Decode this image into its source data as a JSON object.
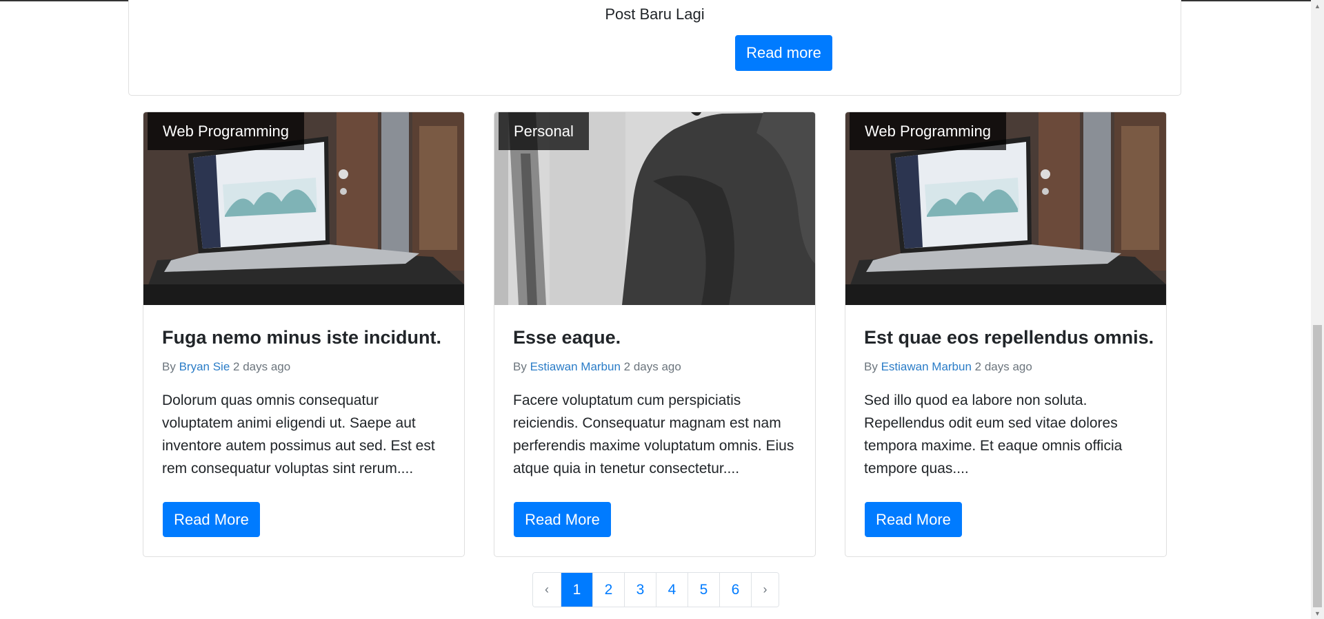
{
  "hero": {
    "title": "Post Baru Lagi",
    "button_label": "Read more"
  },
  "cards": [
    {
      "category": "Web Programming",
      "image": "laptop-dashboard",
      "title": "Fuga nemo minus iste incidunt.",
      "by": "By",
      "author": "Bryan Sie",
      "time": "2 days ago",
      "excerpt": "Dolorum quas omnis consequatur voluptatem animi eligendi ut. Saepe aut inventore autem possimus aut sed. Est est rem consequatur voluptas sint rerum....",
      "button_label": "Read More"
    },
    {
      "category": "Personal",
      "image": "person-grayscale",
      "title": "Esse eaque.",
      "by": "By",
      "author": "Estiawan Marbun",
      "time": "2 days ago",
      "excerpt": "Facere voluptatum cum perspiciatis reiciendis. Consequatur magnam est nam perferendis maxime voluptatum omnis. Eius atque quia in tenetur consectetur....",
      "button_label": "Read More"
    },
    {
      "category": "Web Programming",
      "image": "laptop-dashboard",
      "title": "Est quae eos repellendus omnis.",
      "by": "By",
      "author": "Estiawan Marbun",
      "time": "2 days ago",
      "excerpt": "Sed illo quod ea labore non soluta. Repellendus odit eum sed vitae dolores tempora maxime. Et eaque omnis officia tempore quas....",
      "button_label": "Read More"
    }
  ],
  "pagination": {
    "prev": "‹",
    "pages": [
      "1",
      "2",
      "3",
      "4",
      "5",
      "6"
    ],
    "active": "1",
    "next": "›"
  },
  "colors": {
    "primary": "#007bff",
    "link": "#2a7cc7",
    "muted": "#6c757d"
  }
}
